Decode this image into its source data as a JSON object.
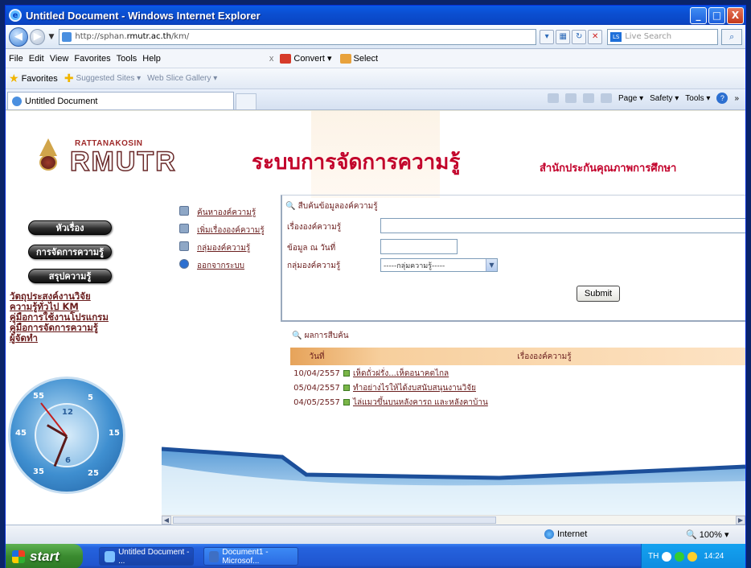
{
  "window": {
    "title": "Untitled Document - Windows Internet Explorer",
    "minimize": "_",
    "maximize": "□",
    "close": "X"
  },
  "address": {
    "url_prefix": "http://sphan.",
    "url_host": "rmutr.ac.th",
    "url_suffix": "/km/",
    "search_placeholder": "Live Search"
  },
  "menu": {
    "items": [
      "File",
      "Edit",
      "View",
      "Favorites",
      "Tools",
      "Help"
    ],
    "close_x": "x",
    "convert": "Convert",
    "select": "Select"
  },
  "favorites": {
    "label": "Favorites",
    "suggested": "Suggested Sites ▾",
    "webslice": "Web Slice Gallery ▾"
  },
  "tabs": {
    "active": "Untitled Document"
  },
  "commandbar": {
    "page": "Page ▾",
    "safety": "Safety ▾",
    "tools": "Tools ▾",
    "more": "»"
  },
  "header": {
    "logo_small": "RATTANAKOSIN",
    "logo_big": "RMUTR",
    "main_title": "ระบบการจัดการความรู้",
    "sub_title": "สำนักประกันคุณภาพการศึกษา"
  },
  "leftnav": {
    "pills": [
      "หัวเรื่อง",
      "การจัดการความรู้",
      "สรุปความรู้"
    ],
    "links": [
      "วัตถุประสงค์งานวิจัย",
      "ความรู้ทั่วไป KM",
      "คู่มือการใช้งานโปรแกรม",
      "คู่มือการจัดการความรู้",
      "ผู้จัดทำ"
    ],
    "clock_numbers": [
      "55",
      "5",
      "15",
      "45",
      "35",
      "25",
      "12",
      "6"
    ]
  },
  "midnav": {
    "items": [
      "ค้นหาองค์ความรู้",
      "เพิ่มเรื่ององค์ความรู้",
      "กลุ่มองค์ความรู้",
      "ออกจากระบบ"
    ]
  },
  "search": {
    "heading": "สืบค้นข้อมูลองค์ความรู้",
    "label_topic": "เรื่ององค์ความรู้",
    "label_date": "ข้อมูล ณ วันที่",
    "label_group": "กลุ่มองค์ความรู้",
    "group_selected": "-----กลุ่มความรู้-----",
    "submit": "Submit"
  },
  "results": {
    "heading": "ผลการสืบค้น",
    "col_date": "วันที่",
    "col_topic": "เรื่ององค์ความรู้",
    "rows": [
      {
        "date": "10/04/2557",
        "title": "เห็ดถั่วฝรั่ง...เห็ดอนาคตไกล"
      },
      {
        "date": "05/04/2557",
        "title": "ทำอย่างไรให้ได้งบสนับสนุนงานวิจัย"
      },
      {
        "date": "04/05/2557",
        "title": "ไล่แมวขึ้นบนหลังคารถ และหลังคาบ้าน"
      }
    ]
  },
  "status": {
    "zone": "Internet",
    "zoom": "100%"
  },
  "taskbar": {
    "start": "start",
    "task1": "Untitled Document - ...",
    "task2": "Document1 - Microsof...",
    "lang": "TH",
    "time": "14:24"
  }
}
